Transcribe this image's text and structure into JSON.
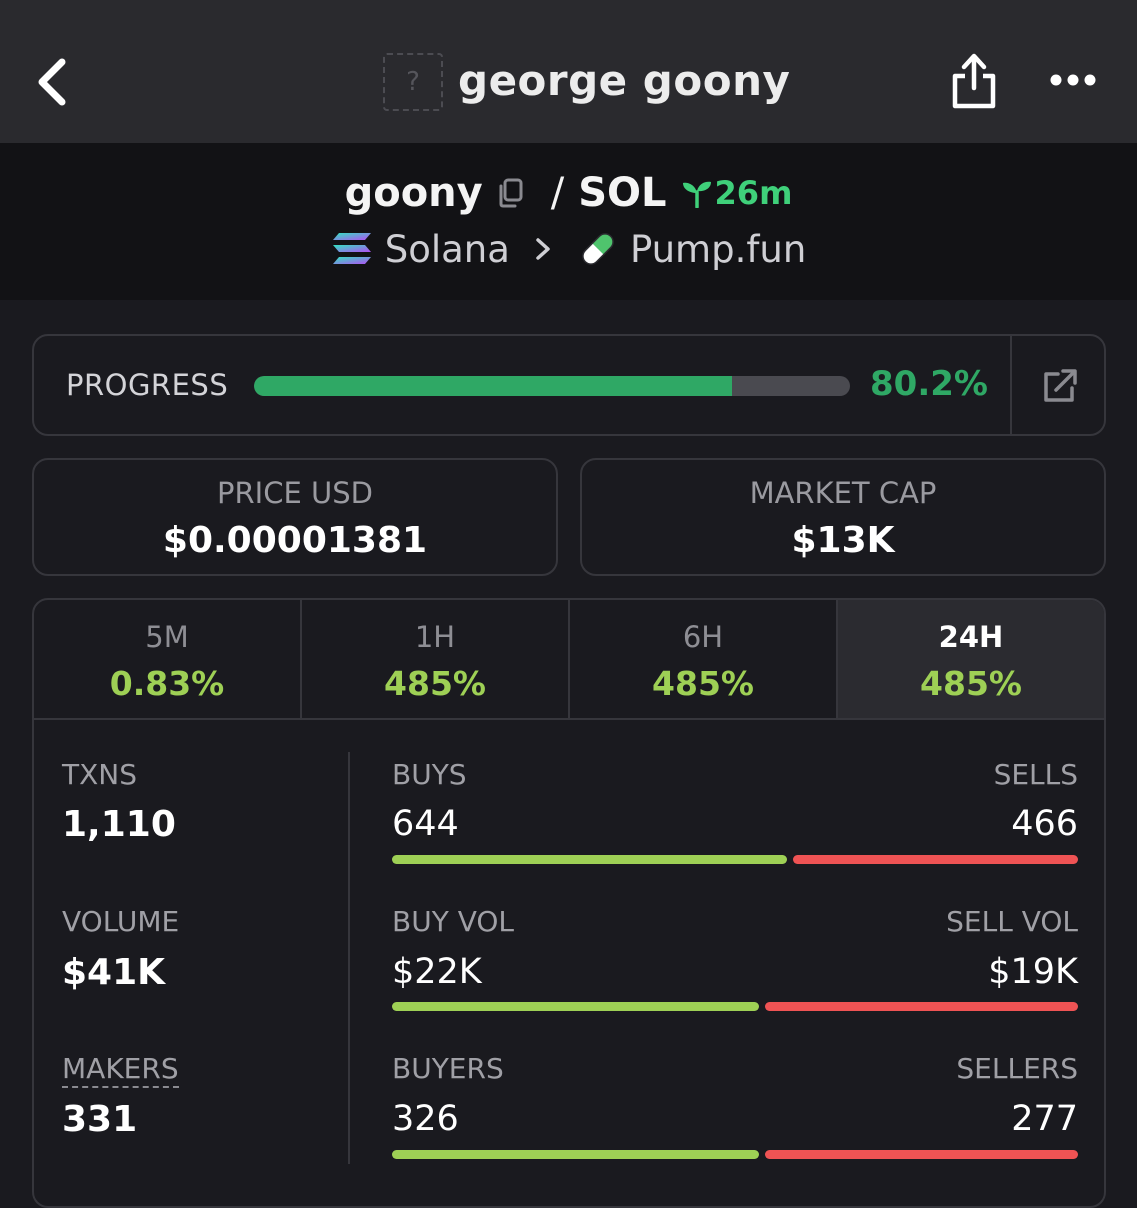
{
  "header": {
    "title": "george goony",
    "thumb_placeholder": "?"
  },
  "pair": {
    "base": "goony",
    "slash": "/",
    "quote": "SOL",
    "age": "26m",
    "chain": "Solana",
    "dex": "Pump.fun"
  },
  "progress": {
    "label": "PROGRESS",
    "value_text": "80.2%",
    "fraction": 0.802
  },
  "stats": {
    "price_label": "PRICE USD",
    "price_value": "$0.00001381",
    "mcap_label": "MARKET CAP",
    "mcap_value": "$13K"
  },
  "tabs": [
    {
      "label": "5M",
      "value": "0.83%"
    },
    {
      "label": "1H",
      "value": "485%"
    },
    {
      "label": "6H",
      "value": "485%"
    },
    {
      "label": "24H",
      "value": "485%",
      "active": true
    }
  ],
  "metrics": {
    "txns_label": "TXNS",
    "txns_value": "1,110",
    "volume_label": "VOLUME",
    "volume_value": "$41K",
    "makers_label": "MAKERS",
    "makers_value": "331"
  },
  "splits": [
    {
      "left_label": "BUYS",
      "right_label": "SELLS",
      "left_value": "644",
      "right_value": "466",
      "left_share": 0.58
    },
    {
      "left_label": "BUY VOL",
      "right_label": "SELL VOL",
      "left_value": "$22K",
      "right_value": "$19K",
      "left_share": 0.54
    },
    {
      "left_label": "BUYERS",
      "right_label": "SELLERS",
      "left_value": "326",
      "right_value": "277",
      "left_share": 0.54
    }
  ],
  "colors": {
    "buy": "#9ed055",
    "sell": "#ef5354",
    "progress": "#2fa865",
    "age": "#3fd07a"
  }
}
